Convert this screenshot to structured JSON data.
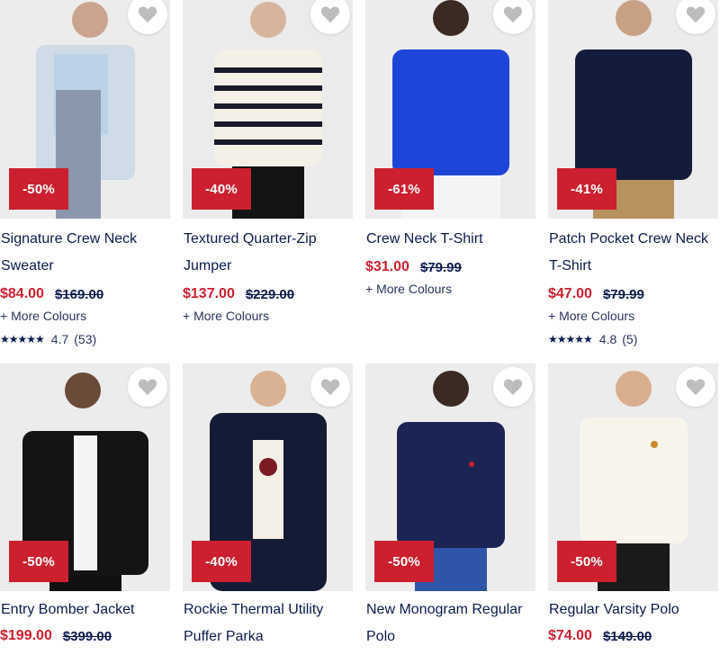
{
  "colors": {
    "badge": "#cc1f2f",
    "price_now": "#cc1f2f",
    "navy": "#0b1a4f"
  },
  "products": [
    {
      "name_line1": "Signature Crew Neck",
      "name_line2": "Sweater",
      "discount": "-50%",
      "price_now": "$84.00",
      "price_was": "$169.00",
      "colours": "+ More Colours",
      "stars": "★★★★★",
      "rating": "4.7",
      "reviews": "(53)",
      "icon": "heart-icon"
    },
    {
      "name_line1": "Textured Quarter-Zip",
      "name_line2": "Jumper",
      "discount": "-40%",
      "price_now": "$137.00",
      "price_was": "$229.00",
      "colours": "+ More Colours",
      "icon": "heart-icon"
    },
    {
      "name_line1": "Crew Neck T-Shirt",
      "discount": "-61%",
      "price_now": "$31.00",
      "price_was": "$79.99",
      "colours": "+ More Colours",
      "icon": "heart-icon"
    },
    {
      "name_line1": "Patch Pocket Crew Neck",
      "name_line2": "T-Shirt",
      "discount": "-41%",
      "price_now": "$47.00",
      "price_was": "$79.99",
      "colours": "+ More Colours",
      "stars": "★★★★★",
      "rating": "4.8",
      "reviews": "(5)",
      "icon": "heart-icon"
    },
    {
      "name_line1": "Entry Bomber Jacket",
      "discount": "-50%",
      "price_now": "$199.00",
      "price_was": "$399.00",
      "icon": "heart-icon"
    },
    {
      "name_line1": "Rockie Thermal Utility",
      "name_line2": "Puffer Parka",
      "discount": "-40%",
      "icon": "heart-icon"
    },
    {
      "name_line1": "New Monogram Regular",
      "name_line2": "Polo",
      "discount": "-50%",
      "icon": "heart-icon"
    },
    {
      "name_line1": "Regular Varsity Polo",
      "discount": "-50%",
      "price_now": "$74.00",
      "price_was": "$149.00",
      "icon": "heart-icon"
    }
  ]
}
